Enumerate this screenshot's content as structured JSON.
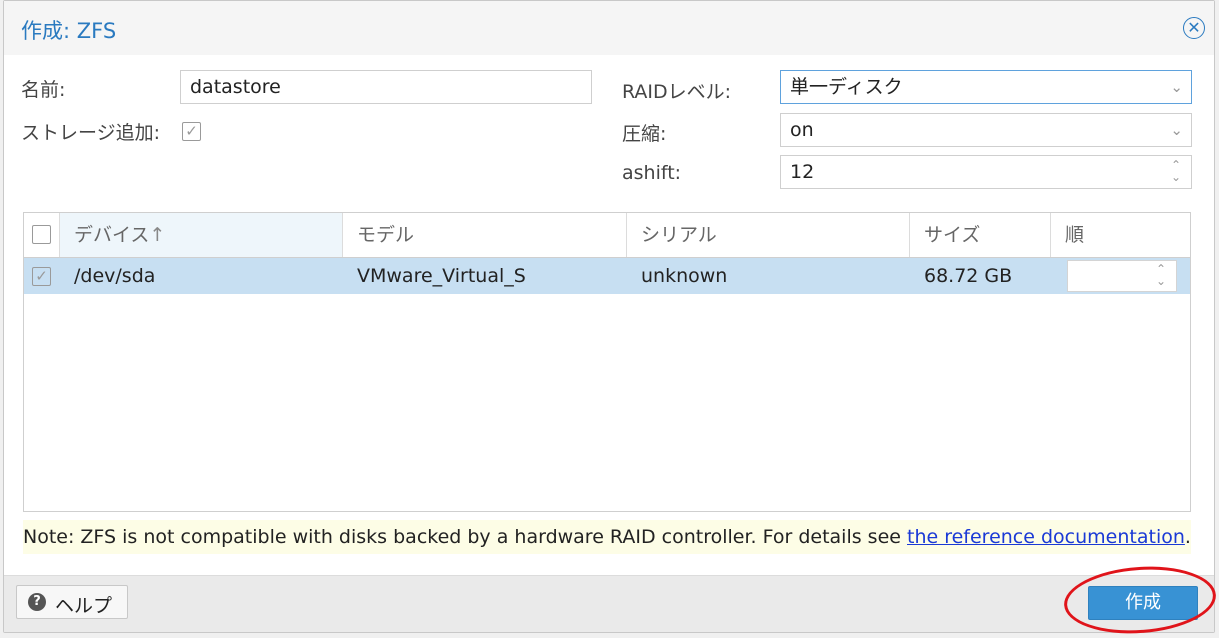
{
  "dialog": {
    "title": "作成: ZFS",
    "close_icon": "close-icon"
  },
  "form": {
    "name_label": "名前:",
    "name_value": "datastore",
    "add_storage_label": "ストレージ追加:",
    "add_storage_checked": true,
    "raid_label": "RAIDレベル:",
    "raid_value": "単一ディスク",
    "compression_label": "圧縮:",
    "compression_value": "on",
    "ashift_label": "ashift:",
    "ashift_value": "12"
  },
  "grid": {
    "columns": [
      "デバイス",
      "モデル",
      "シリアル",
      "サイズ",
      "順"
    ],
    "sort_indicator": "↑",
    "rows": [
      {
        "selected": true,
        "device": "/dev/sda",
        "model": "VMware_Virtual_S",
        "serial": "unknown",
        "size": "68.72 GB",
        "order": ""
      }
    ]
  },
  "note": {
    "text": "Note: ZFS is not compatible with disks backed by a hardware RAID controller. For details see ",
    "link": "the reference documentation",
    "suffix": "."
  },
  "footer": {
    "help_label": "ヘルプ",
    "create_label": "作成"
  },
  "colors": {
    "accent": "#2a7ac0",
    "selected_row": "#c7dff2",
    "primary_button": "#3892d4",
    "annotation": "#e0141a"
  }
}
